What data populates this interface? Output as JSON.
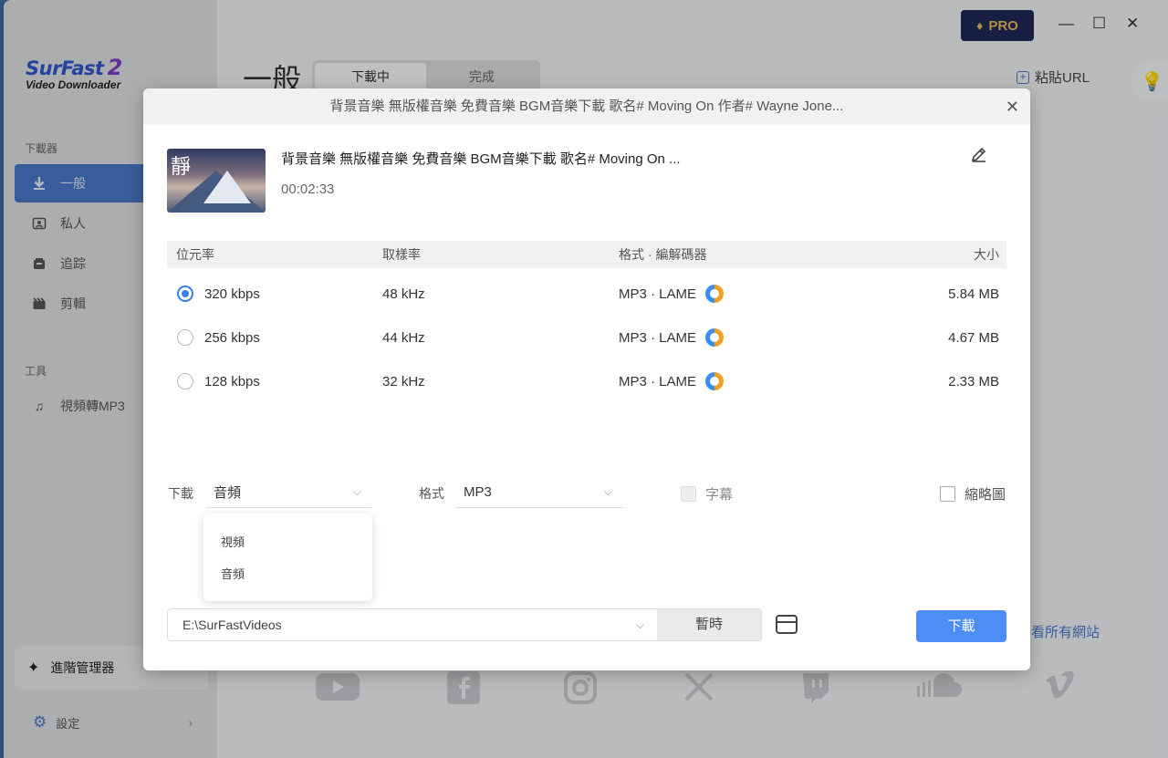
{
  "app": {
    "logo_main": "SurFast",
    "logo_num": "2",
    "logo_sub": "Video Downloader",
    "pro_label": "PRO",
    "page_title": "一般",
    "tabs": [
      {
        "label": "下載中"
      },
      {
        "label": "完成"
      }
    ],
    "paste_url": "粘貼URL",
    "see_all": "看所有網站"
  },
  "sidebar": {
    "section_downloader": "下載器",
    "items": [
      {
        "label": "一般",
        "icon": "download-arrow-icon"
      },
      {
        "label": "私人",
        "icon": "private-icon"
      },
      {
        "label": "追踪",
        "icon": "track-icon"
      },
      {
        "label": "剪輯",
        "icon": "clip-icon"
      }
    ],
    "section_tools": "工具",
    "tools": [
      {
        "label": "視頻轉MP3",
        "icon": "music-note-icon"
      }
    ],
    "advanced": "進階管理器",
    "settings": "設定"
  },
  "dialog": {
    "header_title": "背景音樂 無版權音樂 免費音樂 BGM音樂下載 歌名# Moving On  作者# Wayne Jone...",
    "video_title": "背景音樂 無版權音樂 免費音樂 BGM音樂下載 歌名# Moving On  ...",
    "thumb_glyph": "靜",
    "duration": "00:02:33",
    "columns": {
      "bitrate": "位元率",
      "samplerate": "取樣率",
      "format": "格式 · 編解碼器",
      "size": "大小"
    },
    "rows": [
      {
        "bitrate": "320 kbps",
        "samplerate": "48 kHz",
        "format": "MP3 · LAME",
        "size": "5.84 MB",
        "selected": true
      },
      {
        "bitrate": "256 kbps",
        "samplerate": "44 kHz",
        "format": "MP3 · LAME",
        "size": "4.67 MB",
        "selected": false
      },
      {
        "bitrate": "128 kbps",
        "samplerate": "32 kHz",
        "format": "MP3 · LAME",
        "size": "2.33 MB",
        "selected": false
      }
    ],
    "download_label": "下載",
    "download_type_value": "音頻",
    "format_label": "格式",
    "format_value": "MP3",
    "subtitle_label": "字幕",
    "thumbnail_label": "縮略圖",
    "dropdown_options": [
      {
        "label": "視頻"
      },
      {
        "label": "音頻"
      }
    ],
    "path_value": "E:\\SurFastVideos",
    "temp_button": "暫時",
    "download_button": "下載"
  },
  "colors": {
    "accent": "#4c8ef5",
    "sidebar_active": "#4a78c7",
    "pro_bg": "#1e2a55",
    "pro_text": "#e7b55a"
  }
}
